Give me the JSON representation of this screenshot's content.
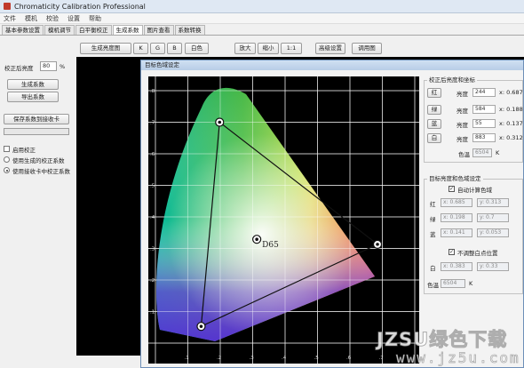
{
  "window": {
    "title": "Chromaticity Calibration Professional"
  },
  "menu": [
    "文件",
    "模机",
    "校验",
    "设置",
    "帮助"
  ],
  "tabs": [
    "基本参数设置",
    "模机调节",
    "白平衡校正",
    "生成系数",
    "图片查看",
    "系数转换"
  ],
  "toolbar": {
    "generate_image": "生成亮度图",
    "k": "K",
    "g": "G",
    "b": "B",
    "white": "白色",
    "zoom_in": "放大",
    "zoom_out": "缩小",
    "one_to_one": "1:1",
    "advanced_settings": "高级设置",
    "open_image": "调用图"
  },
  "left_panel": {
    "correction_brightness_label": "校正后亮度",
    "correction_brightness_value": "80",
    "correction_brightness_unit": "%",
    "generate_coeff": "生成系数",
    "export_coeff": "导出系数",
    "save_coeff_to_card": "保存系数到接收卡",
    "enable_correction": "启用校正",
    "radio_generated": "使用生成的校正系数",
    "radio_card": "使用接收卡中校正系数"
  },
  "dialog": {
    "title": "目标色域设定",
    "target_group_title": "校正后亮度和坐标",
    "rows": [
      {
        "button": "红",
        "label": "亮度",
        "value": "244",
        "coord": "x: 0.687"
      },
      {
        "button": "绿",
        "label": "亮度",
        "value": "584",
        "coord": "x: 0.188"
      },
      {
        "button": "蓝",
        "label": "亮度",
        "value": "55",
        "coord": "x: 0.137"
      },
      {
        "button": "白",
        "label": "亮度",
        "value": "883",
        "coord": "x: 0.312"
      }
    ],
    "color_temp_label": "色温",
    "color_temp_value": "6504",
    "color_temp_unit": "K",
    "settings_group_title": "目标亮度和色域设定",
    "auto_calc_label": "自动计算色域",
    "coord_rows": [
      {
        "label": "红",
        "x": "x: 0.685",
        "y": "y: 0.313"
      },
      {
        "label": "绿",
        "x": "x: 0.198",
        "y": "y: 0.7"
      },
      {
        "label": "蓝",
        "x": "x: 0.141",
        "y": "y: 0.053"
      }
    ],
    "keep_white_label": "不调整白点位置",
    "white_row": {
      "label": "白",
      "x": "x: 0.383",
      "y": "y: 0.33"
    },
    "color_temp2_label": "色温",
    "color_temp2_value": "6504",
    "color_temp2_unit": "K",
    "d65_label": "D65",
    "axis_ticks_x": [
      ".1",
      ".2",
      ".3",
      ".4",
      ".5",
      ".6",
      ".7"
    ],
    "axis_ticks_y": [
      ".1",
      ".2",
      ".3",
      ".4",
      ".5",
      ".6",
      ".7",
      ".8"
    ],
    "gamut": {
      "red": [
        0.685,
        0.313
      ],
      "green": [
        0.198,
        0.7
      ],
      "blue": [
        0.141,
        0.053
      ],
      "white": [
        0.3127,
        0.329
      ]
    }
  },
  "watermark": {
    "line1": "JZSU绿色下载",
    "line2": "www.jz5u.com"
  }
}
